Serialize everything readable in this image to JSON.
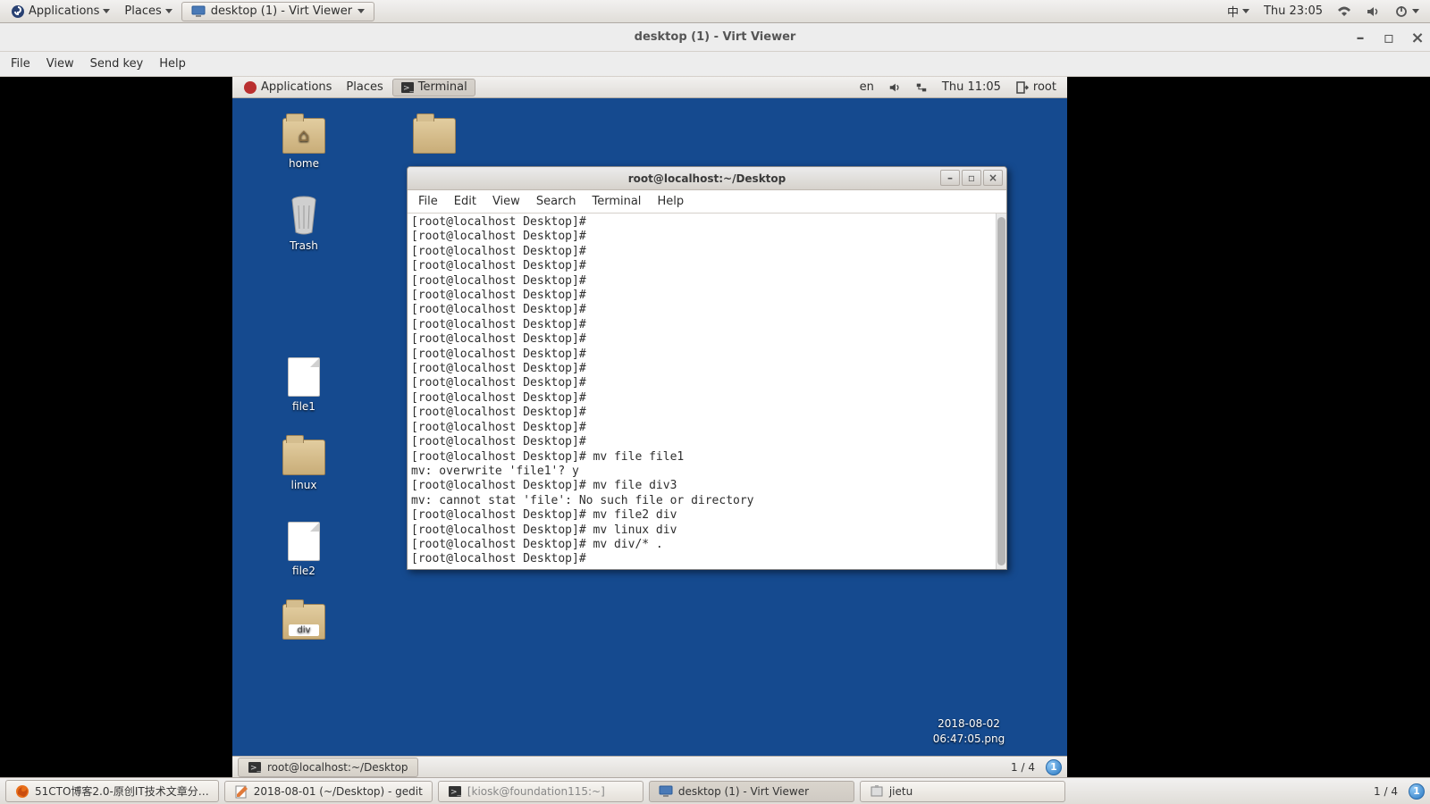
{
  "outer_panel": {
    "applications": "Applications",
    "places": "Places",
    "task_title": "desktop (1) - Virt Viewer",
    "lang": "中",
    "clock": "Thu 23:05"
  },
  "virt_viewer": {
    "title": "desktop (1) - Virt Viewer",
    "menu": {
      "file": "File",
      "view": "View",
      "sendkey": "Send key",
      "help": "Help"
    }
  },
  "guest_panel": {
    "applications": "Applications",
    "places": "Places",
    "task_title": "Terminal",
    "lang": "en",
    "clock": "Thu 11:05",
    "user": "root"
  },
  "desktop_icons": {
    "home": "home",
    "trash": "Trash",
    "file1": "file1",
    "linux": "linux",
    "file2": "file2",
    "div": "div"
  },
  "png_label": {
    "line1": "2018-08-02",
    "line2": "06:47:05.png"
  },
  "terminal": {
    "title": "root@localhost:~/Desktop",
    "menu": {
      "file": "File",
      "edit": "Edit",
      "view": "View",
      "search": "Search",
      "terminal": "Terminal",
      "help": "Help"
    },
    "lines": [
      "[root@localhost Desktop]#",
      "[root@localhost Desktop]#",
      "[root@localhost Desktop]#",
      "[root@localhost Desktop]#",
      "[root@localhost Desktop]#",
      "[root@localhost Desktop]#",
      "[root@localhost Desktop]#",
      "[root@localhost Desktop]#",
      "[root@localhost Desktop]#",
      "[root@localhost Desktop]#",
      "[root@localhost Desktop]#",
      "[root@localhost Desktop]#",
      "[root@localhost Desktop]#",
      "[root@localhost Desktop]#",
      "[root@localhost Desktop]#",
      "[root@localhost Desktop]#",
      "[root@localhost Desktop]# mv file file1",
      "mv: overwrite 'file1'? y",
      "[root@localhost Desktop]# mv file div3",
      "mv: cannot stat 'file': No such file or directory",
      "[root@localhost Desktop]# mv file2 div",
      "[root@localhost Desktop]# mv linux div",
      "[root@localhost Desktop]# mv div/* .",
      "[root@localhost Desktop]#"
    ]
  },
  "guest_bottom": {
    "task": "root@localhost:~/Desktop",
    "workspace": "1 / 4"
  },
  "outer_bottom": {
    "tasks": [
      "51CTO博客2.0-原创IT技术文章分…",
      "2018-08-01 (~/Desktop) - gedit",
      "[kiosk@foundation115:~]",
      "desktop (1) - Virt Viewer",
      "jietu"
    ],
    "workspace": "1 / 4"
  }
}
